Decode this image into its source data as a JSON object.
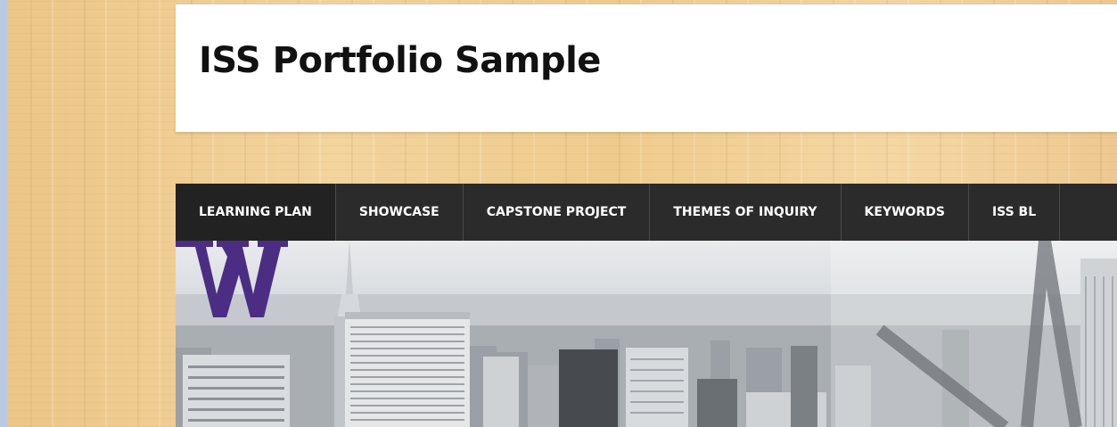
{
  "site": {
    "title": "ISS Portfolio Sample"
  },
  "nav": {
    "items": [
      {
        "label": "LEARNING PLAN",
        "name": "nav-item-learning-plan"
      },
      {
        "label": "SHOWCASE",
        "name": "nav-item-showcase"
      },
      {
        "label": "CAPSTONE PROJECT",
        "name": "nav-item-capstone-project"
      },
      {
        "label": "THEMES OF INQUIRY",
        "name": "nav-item-themes-of-inquiry"
      },
      {
        "label": "KEYWORDS",
        "name": "nav-item-keywords"
      },
      {
        "label": "ISS BL",
        "name": "nav-item-iss-blog"
      }
    ]
  },
  "banner": {
    "logo_letter": "W",
    "logo_color": "#4b2e83"
  },
  "colors": {
    "nav_background": "#2b2b2b",
    "nav_text": "#ffffff",
    "wood_background": "#efcb8d"
  }
}
